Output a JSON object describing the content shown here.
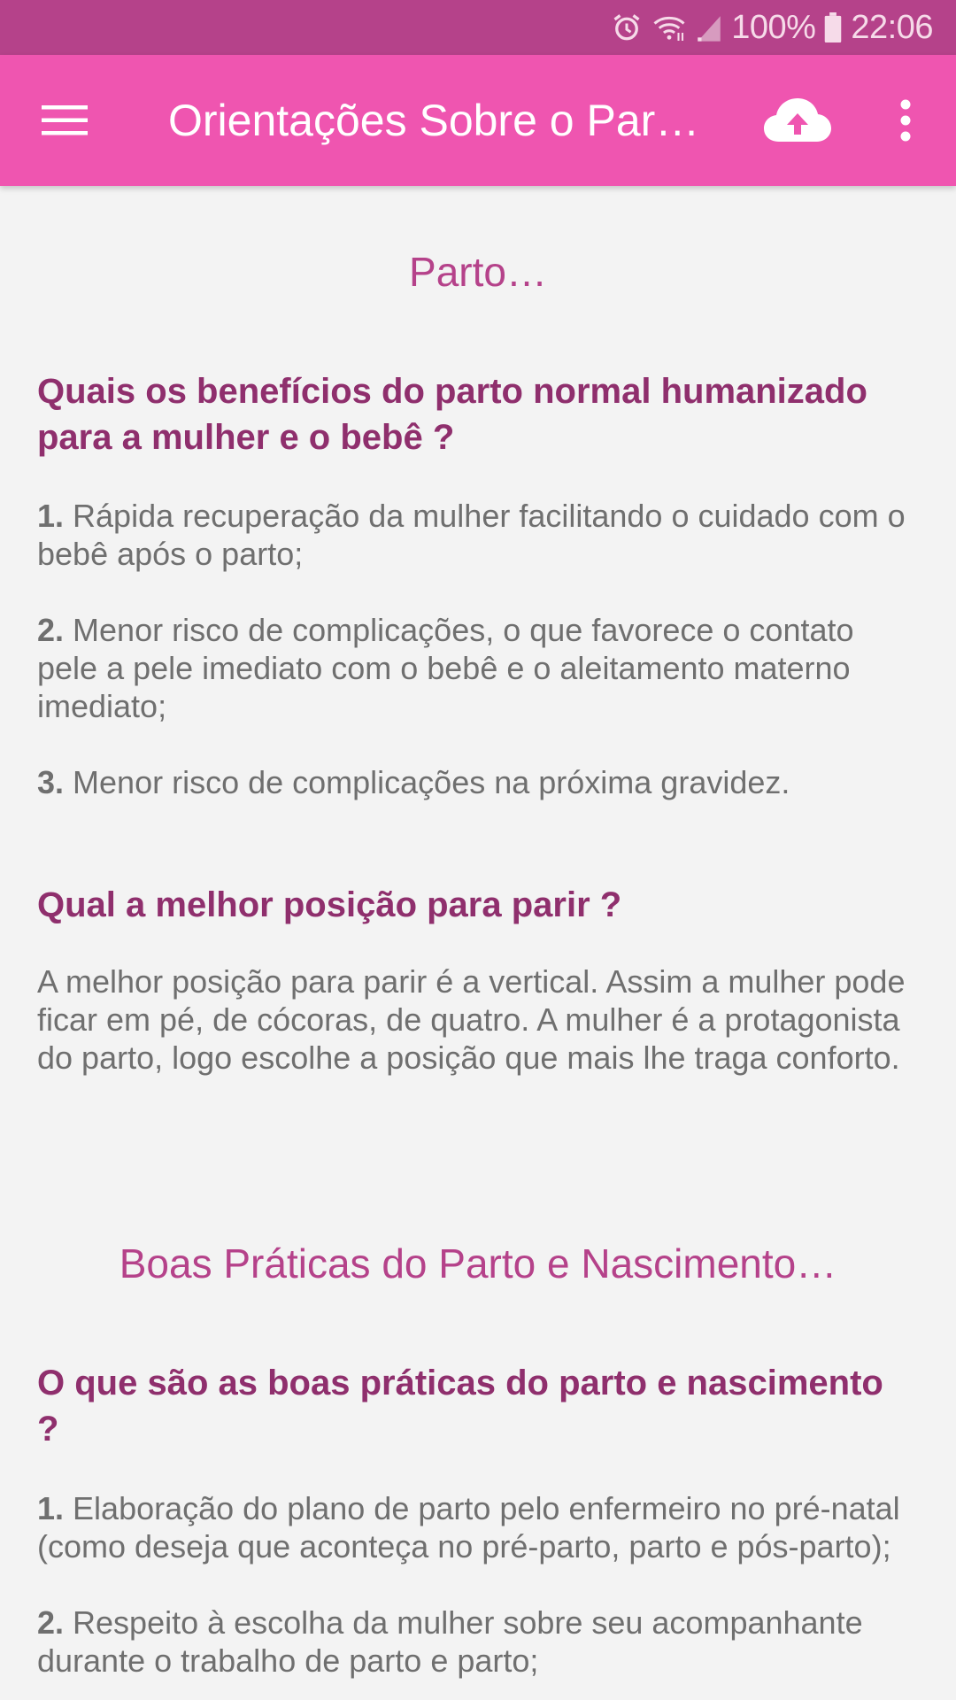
{
  "status_bar": {
    "battery": "100%",
    "time": "22:06",
    "icons": [
      "alarm-icon",
      "wifi-icon",
      "signal-icon",
      "battery-icon"
    ]
  },
  "app_bar": {
    "title": "Orientações Sobre o Par…",
    "icons": [
      "menu-icon",
      "cloud-upload-icon",
      "more-vert-icon"
    ],
    "color": "#ef55b0"
  },
  "sections": [
    {
      "title": "Parto…",
      "questions": [
        {
          "question": "Quais os benefícios do parto normal humanizado para a mulher e o bebê ?",
          "items": [
            {
              "num": "1.",
              "text": " Rápida recuperação da mulher facilitando o cuidado com o bebê após o parto;"
            },
            {
              "num": "2.",
              "text": " Menor risco de complicações, o que favorece o contato pele a pele imediato com o bebê e o aleitamento materno imediato;"
            },
            {
              "num": "3.",
              "text": " Menor risco de complicações na próxima gravidez."
            }
          ]
        },
        {
          "question": "Qual a melhor posição para parir ?",
          "answer": "A melhor posição para parir é a vertical. Assim a mulher pode ficar em pé, de cócoras, de quatro. A mulher é a protagonista do parto, logo escolhe a posição que mais lhe traga conforto."
        }
      ]
    },
    {
      "title": "Boas Práticas do Parto e Nascimento…",
      "questions": [
        {
          "question": "O que são as boas práticas do parto e nascimento ?",
          "items": [
            {
              "num": "1.",
              "text": " Elaboração do plano de parto pelo enfermeiro no pré-natal (como deseja que aconteça no pré-parto, parto e pós-parto);"
            },
            {
              "num": "2.",
              "text": " Respeito à escolha da mulher sobre seu acompanhante durante o trabalho de parto e parto;"
            }
          ]
        }
      ]
    }
  ],
  "colors": {
    "status_bar": "#b5428a",
    "section_title": "#b5428a",
    "question": "#8f2f6d",
    "body_text": "#6f6f6f",
    "background": "#f3f3f3"
  }
}
